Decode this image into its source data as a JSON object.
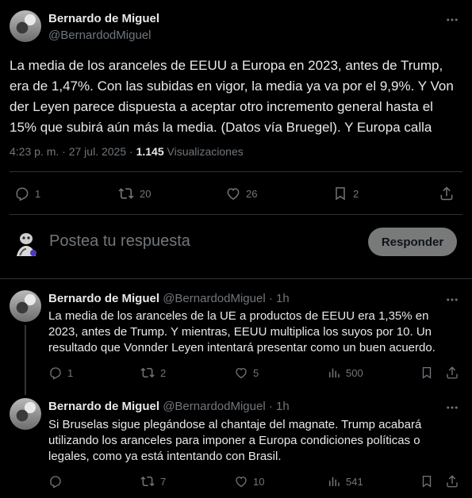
{
  "main_tweet": {
    "author_name": "Bernardo de Miguel",
    "author_handle": "@BernardodMiguel",
    "text_lines": [
      "La media de los aranceles de EEUU a Europa en 2023, antes de Trump,",
      "era de 1,47%. Con las subidas en vigor, la media ya va por el 9,9%. Y Von",
      "der Leyen parece dispuesta a aceptar otro incremento general hasta el",
      "15% que subirá aún más la media. (Datos vía Bruegel). Y Europa calla"
    ],
    "time": "4:23 p. m.",
    "date": "27 jul. 2025",
    "views_count": "1.145",
    "views_label": "Visualizaciones",
    "separator": "·",
    "replies": "1",
    "reposts": "20",
    "likes": "26",
    "bookmarks": "2"
  },
  "composer": {
    "placeholder": "Postea tu respuesta",
    "button_label": "Responder"
  },
  "replies": [
    {
      "author_name": "Bernardo de Miguel",
      "author_handle": "@BernardodMiguel",
      "separator": "·",
      "age": "1h",
      "text_lines": [
        "La media de los aranceles de la UE a productos de EEUU era 1,35% en",
        "2023, antes de Trump. Y mientras, EEUU multiplica los suyos por 10. Un",
        "resultado que Vonnder Leyen intentará presentar como un buen acuerdo."
      ],
      "replies": "1",
      "reposts": "2",
      "likes": "5",
      "views": "500"
    },
    {
      "author_name": "Bernardo de Miguel",
      "author_handle": "@BernardodMiguel",
      "separator": "·",
      "age": "1h",
      "text_lines": [
        "Si Bruselas sigue plegándose al chantaje del magnate. Trump acabará",
        "utilizando los aranceles para imponer a Europa condiciones políticas o",
        "legales, como ya está intentando con Brasil."
      ],
      "replies": "",
      "reposts": "7",
      "likes": "10",
      "views": "541"
    }
  ],
  "colors": {
    "background": "#000000",
    "text": "#e7e9ea",
    "muted": "#71767b",
    "divider": "#2f3336",
    "button_bg": "#787a7a"
  }
}
